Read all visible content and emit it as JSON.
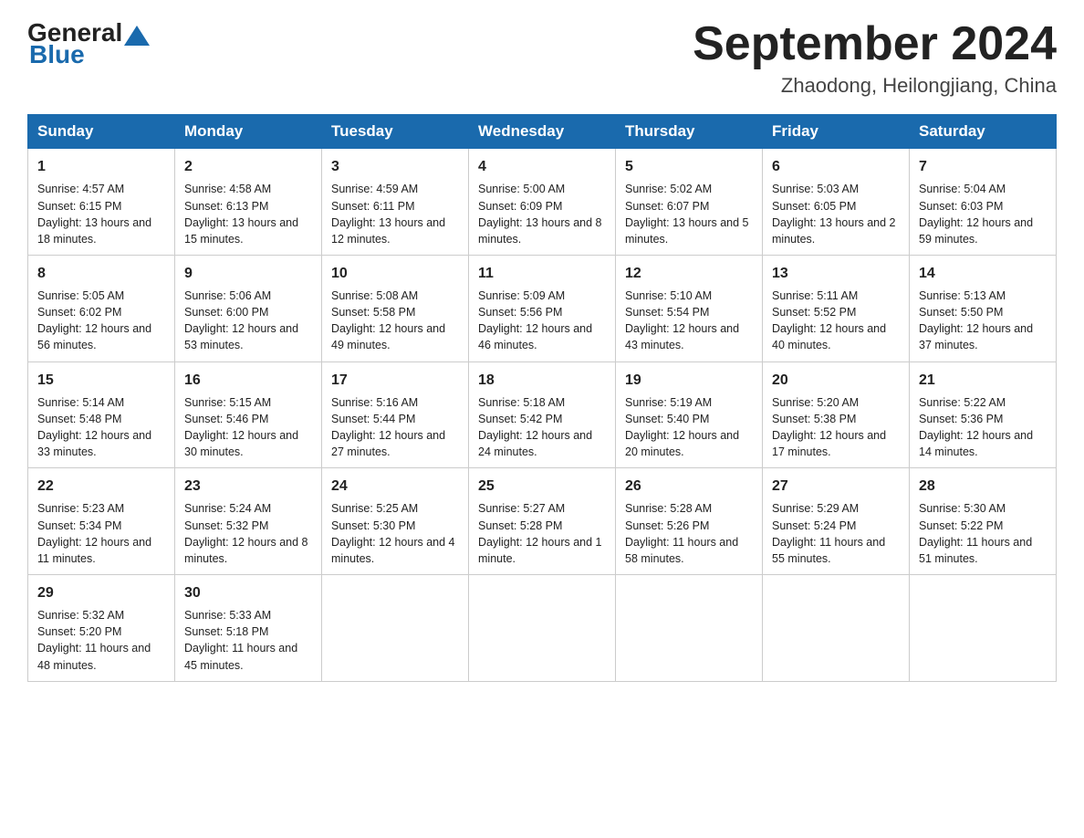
{
  "header": {
    "logo": {
      "general": "General",
      "blue": "Blue"
    },
    "title": "September 2024",
    "location": "Zhaodong, Heilongjiang, China"
  },
  "weekdays": [
    "Sunday",
    "Monday",
    "Tuesday",
    "Wednesday",
    "Thursday",
    "Friday",
    "Saturday"
  ],
  "weeks": [
    [
      {
        "day": "1",
        "sunrise": "4:57 AM",
        "sunset": "6:15 PM",
        "daylight": "13 hours and 18 minutes."
      },
      {
        "day": "2",
        "sunrise": "4:58 AM",
        "sunset": "6:13 PM",
        "daylight": "13 hours and 15 minutes."
      },
      {
        "day": "3",
        "sunrise": "4:59 AM",
        "sunset": "6:11 PM",
        "daylight": "13 hours and 12 minutes."
      },
      {
        "day": "4",
        "sunrise": "5:00 AM",
        "sunset": "6:09 PM",
        "daylight": "13 hours and 8 minutes."
      },
      {
        "day": "5",
        "sunrise": "5:02 AM",
        "sunset": "6:07 PM",
        "daylight": "13 hours and 5 minutes."
      },
      {
        "day": "6",
        "sunrise": "5:03 AM",
        "sunset": "6:05 PM",
        "daylight": "13 hours and 2 minutes."
      },
      {
        "day": "7",
        "sunrise": "5:04 AM",
        "sunset": "6:03 PM",
        "daylight": "12 hours and 59 minutes."
      }
    ],
    [
      {
        "day": "8",
        "sunrise": "5:05 AM",
        "sunset": "6:02 PM",
        "daylight": "12 hours and 56 minutes."
      },
      {
        "day": "9",
        "sunrise": "5:06 AM",
        "sunset": "6:00 PM",
        "daylight": "12 hours and 53 minutes."
      },
      {
        "day": "10",
        "sunrise": "5:08 AM",
        "sunset": "5:58 PM",
        "daylight": "12 hours and 49 minutes."
      },
      {
        "day": "11",
        "sunrise": "5:09 AM",
        "sunset": "5:56 PM",
        "daylight": "12 hours and 46 minutes."
      },
      {
        "day": "12",
        "sunrise": "5:10 AM",
        "sunset": "5:54 PM",
        "daylight": "12 hours and 43 minutes."
      },
      {
        "day": "13",
        "sunrise": "5:11 AM",
        "sunset": "5:52 PM",
        "daylight": "12 hours and 40 minutes."
      },
      {
        "day": "14",
        "sunrise": "5:13 AM",
        "sunset": "5:50 PM",
        "daylight": "12 hours and 37 minutes."
      }
    ],
    [
      {
        "day": "15",
        "sunrise": "5:14 AM",
        "sunset": "5:48 PM",
        "daylight": "12 hours and 33 minutes."
      },
      {
        "day": "16",
        "sunrise": "5:15 AM",
        "sunset": "5:46 PM",
        "daylight": "12 hours and 30 minutes."
      },
      {
        "day": "17",
        "sunrise": "5:16 AM",
        "sunset": "5:44 PM",
        "daylight": "12 hours and 27 minutes."
      },
      {
        "day": "18",
        "sunrise": "5:18 AM",
        "sunset": "5:42 PM",
        "daylight": "12 hours and 24 minutes."
      },
      {
        "day": "19",
        "sunrise": "5:19 AM",
        "sunset": "5:40 PM",
        "daylight": "12 hours and 20 minutes."
      },
      {
        "day": "20",
        "sunrise": "5:20 AM",
        "sunset": "5:38 PM",
        "daylight": "12 hours and 17 minutes."
      },
      {
        "day": "21",
        "sunrise": "5:22 AM",
        "sunset": "5:36 PM",
        "daylight": "12 hours and 14 minutes."
      }
    ],
    [
      {
        "day": "22",
        "sunrise": "5:23 AM",
        "sunset": "5:34 PM",
        "daylight": "12 hours and 11 minutes."
      },
      {
        "day": "23",
        "sunrise": "5:24 AM",
        "sunset": "5:32 PM",
        "daylight": "12 hours and 8 minutes."
      },
      {
        "day": "24",
        "sunrise": "5:25 AM",
        "sunset": "5:30 PM",
        "daylight": "12 hours and 4 minutes."
      },
      {
        "day": "25",
        "sunrise": "5:27 AM",
        "sunset": "5:28 PM",
        "daylight": "12 hours and 1 minute."
      },
      {
        "day": "26",
        "sunrise": "5:28 AM",
        "sunset": "5:26 PM",
        "daylight": "11 hours and 58 minutes."
      },
      {
        "day": "27",
        "sunrise": "5:29 AM",
        "sunset": "5:24 PM",
        "daylight": "11 hours and 55 minutes."
      },
      {
        "day": "28",
        "sunrise": "5:30 AM",
        "sunset": "5:22 PM",
        "daylight": "11 hours and 51 minutes."
      }
    ],
    [
      {
        "day": "29",
        "sunrise": "5:32 AM",
        "sunset": "5:20 PM",
        "daylight": "11 hours and 48 minutes."
      },
      {
        "day": "30",
        "sunrise": "5:33 AM",
        "sunset": "5:18 PM",
        "daylight": "11 hours and 45 minutes."
      },
      null,
      null,
      null,
      null,
      null
    ]
  ],
  "labels": {
    "sunrise": "Sunrise:",
    "sunset": "Sunset:",
    "daylight": "Daylight:"
  }
}
